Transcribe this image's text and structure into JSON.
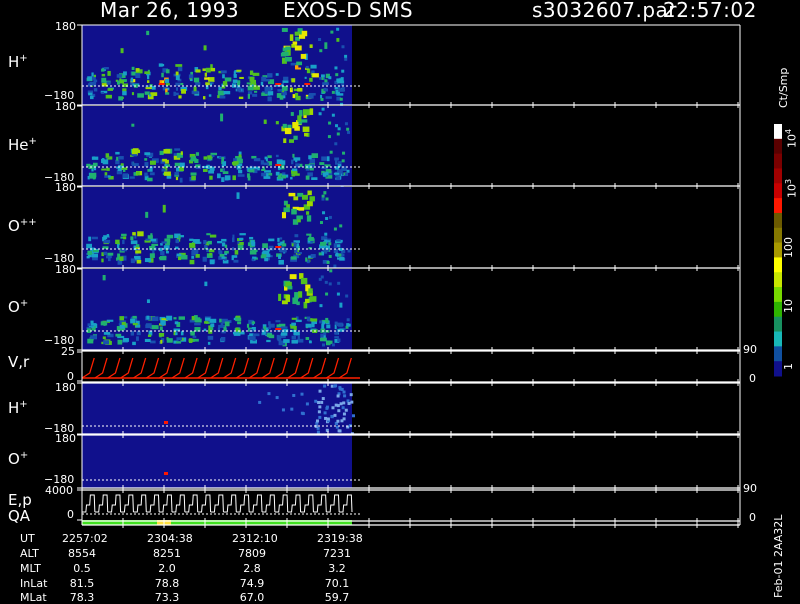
{
  "header": {
    "date": "Mar 26, 1993",
    "instrument": "EXOS-D SMS",
    "file": "s3032607.par",
    "time": "22:57:02"
  },
  "colorbar": {
    "unit": "Ct/Smp",
    "ticks": [
      {
        "label": "10",
        "sup": "4",
        "value": 10000
      },
      {
        "label": "10",
        "sup": "3",
        "value": 1000
      },
      {
        "label": "100",
        "sup": "",
        "value": 100
      },
      {
        "label": "10",
        "sup": "",
        "value": 10
      },
      {
        "label": "1",
        "sup": "",
        "value": 1
      }
    ],
    "colors": [
      "#ffffff",
      "#5a0000",
      "#7a0000",
      "#a00000",
      "#c80000",
      "#ff1800",
      "#6b5a00",
      "#857800",
      "#a89a00",
      "#ffff00",
      "#c8e600",
      "#78d800",
      "#2eb400",
      "#189060",
      "#18b8b8",
      "#1050a0",
      "#10108c"
    ]
  },
  "chart_data": [
    {
      "type": "heatmap",
      "panel": "H+",
      "label": "H",
      "sup": "+",
      "ylim": [
        -180,
        180
      ],
      "yticks": [
        "180",
        "−180"
      ],
      "intensity": [
        3,
        4,
        3,
        5,
        4,
        6,
        5,
        4,
        5,
        3,
        4,
        3,
        2,
        3,
        6,
        5,
        2,
        1
      ],
      "burst_cols": [
        5,
        13,
        15
      ]
    },
    {
      "type": "heatmap",
      "panel": "He+",
      "label": "He",
      "sup": "+",
      "ylim": [
        -180,
        180
      ],
      "yticks": [
        "180",
        "−180"
      ],
      "intensity": [
        2,
        3,
        3,
        4,
        3,
        4,
        4,
        3,
        3,
        2,
        3,
        2,
        2,
        2,
        4,
        3,
        2,
        1
      ],
      "burst_cols": [
        13
      ]
    },
    {
      "type": "heatmap",
      "panel": "O++",
      "label": "O",
      "sup": "++",
      "ylim": [
        -180,
        180
      ],
      "yticks": [
        "180",
        "−180"
      ],
      "intensity": [
        2,
        3,
        3,
        4,
        3,
        3,
        3,
        3,
        3,
        2,
        3,
        2,
        2,
        2,
        3,
        3,
        2,
        1
      ],
      "burst_cols": [
        13
      ]
    },
    {
      "type": "heatmap",
      "panel": "O+",
      "label": "O",
      "sup": "+",
      "ylim": [
        -180,
        180
      ],
      "yticks": [
        "180",
        "−180"
      ],
      "intensity": [
        2,
        3,
        3,
        3,
        3,
        4,
        3,
        3,
        3,
        2,
        3,
        2,
        2,
        2,
        3,
        3,
        2,
        1
      ],
      "burst_cols": [
        13
      ]
    },
    {
      "type": "line",
      "panel": "V,r",
      "label": "V,r",
      "yticks": [
        "25",
        "0"
      ],
      "right_ticks": [
        "90",
        "0"
      ],
      "ylim": [
        0,
        25
      ],
      "cycles": 21
    },
    {
      "type": "heatmap",
      "panel": "H+ (2)",
      "label": "H",
      "sup": "+",
      "ylim": [
        -180,
        180
      ],
      "yticks": [
        "180",
        "−180"
      ]
    },
    {
      "type": "heatmap",
      "panel": "O+ (2)",
      "label": "O",
      "sup": "+",
      "ylim": [
        -180,
        180
      ],
      "yticks": [
        "180",
        "−180"
      ]
    },
    {
      "type": "line",
      "panel": "E,p QA",
      "label": "E,p",
      "label2": "QA",
      "yticks": [
        "4000",
        "0"
      ],
      "right_ticks": [
        "90",
        "0"
      ],
      "ylim": [
        0,
        4000
      ],
      "cycles": 21
    }
  ],
  "footer": {
    "columns": [
      "UT",
      "ALT",
      "MLT",
      "InLat",
      "MLat"
    ],
    "rows": [
      [
        "2257:02",
        "8554",
        "0.5",
        "81.5",
        "78.3"
      ],
      [
        "2304:38",
        "8251",
        "2.0",
        "78.8",
        "73.3"
      ],
      [
        "2312:10",
        "7809",
        "2.8",
        "74.9",
        "67.0"
      ],
      [
        "2319:38",
        "7231",
        "3.2",
        "70.1",
        "59.7"
      ]
    ],
    "stamp": "Feb-01 2AA32L"
  }
}
